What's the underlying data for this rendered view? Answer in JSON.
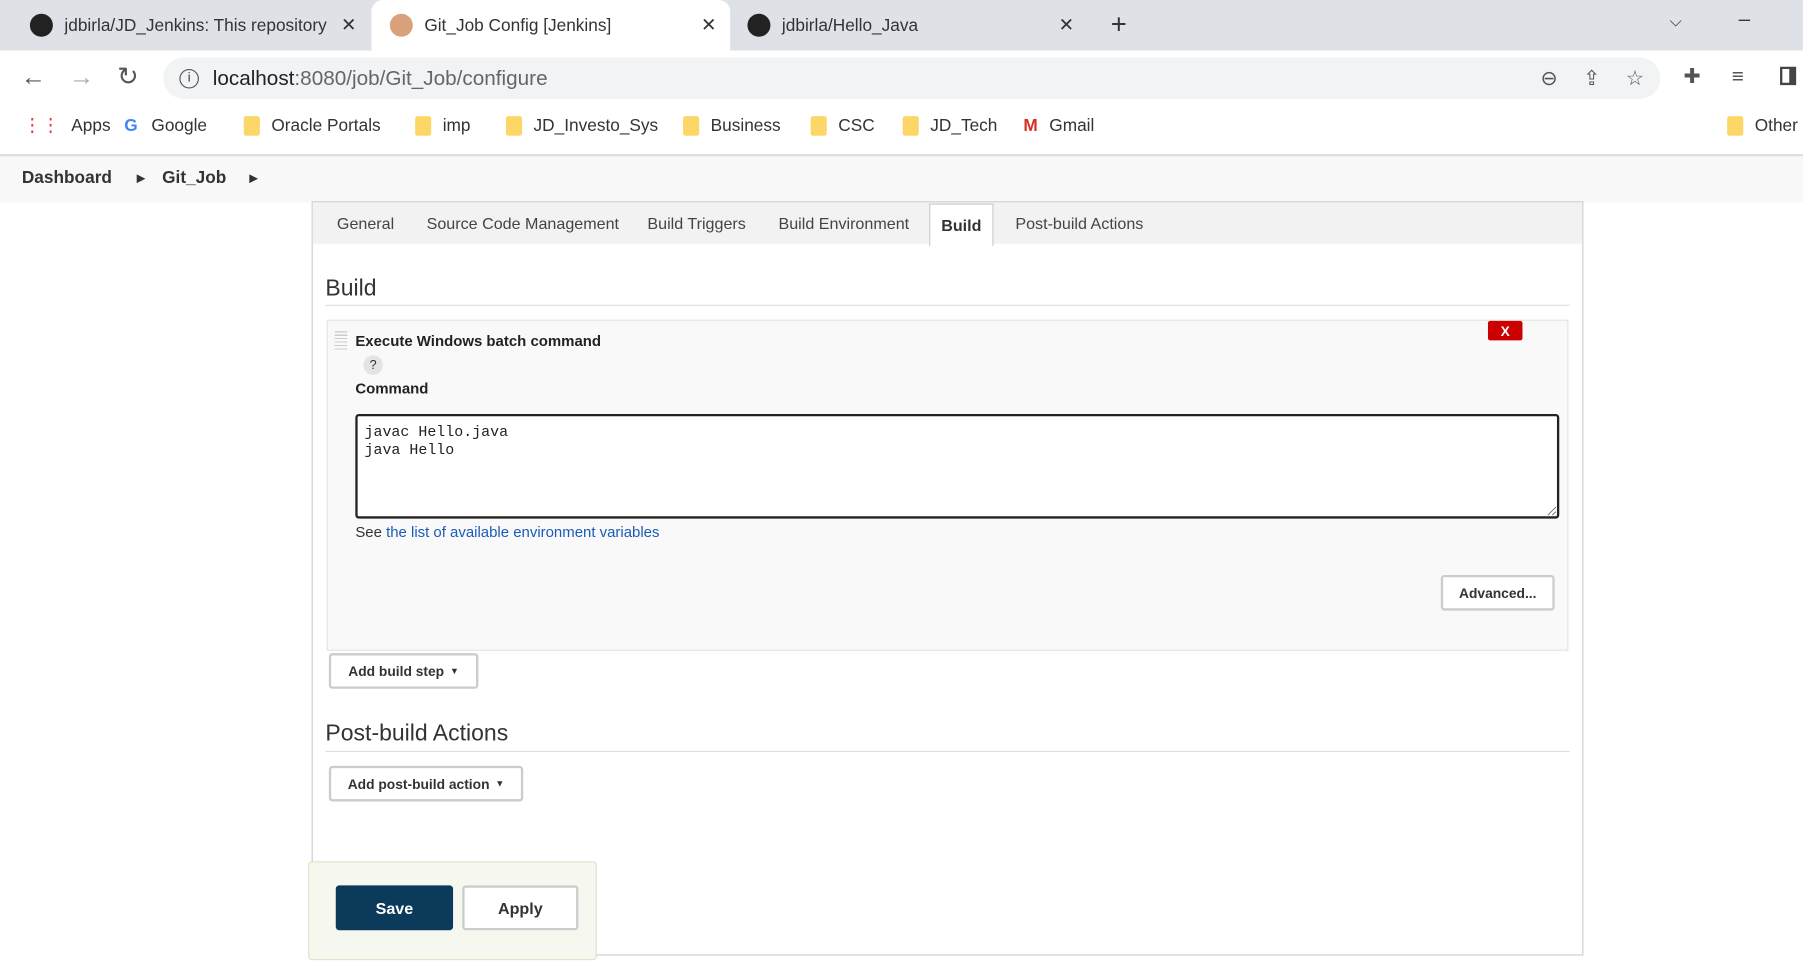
{
  "browser": {
    "tabs": [
      {
        "title": "jdbirla/JD_Jenkins: This repository",
        "icon": "github-icon"
      },
      {
        "title": "Git_Job Config [Jenkins]",
        "icon": "jenkins-icon"
      },
      {
        "title": "jdbirla/Hello_Java",
        "icon": "github-icon"
      }
    ],
    "url_host": "localhost",
    "url_path": ":8080/job/Git_Job/configure",
    "bookmarks": [
      "Apps",
      "Google",
      "Oracle Portals",
      "imp",
      "JD_Investo_Sys",
      "Business",
      "CSC",
      "JD_Tech",
      "Gmail"
    ],
    "other_bookmarks": "Other"
  },
  "breadcrumb": [
    "Dashboard",
    "Git_Job"
  ],
  "config_tabs": [
    "General",
    "Source Code Management",
    "Build Triggers",
    "Build Environment",
    "Build",
    "Post-build Actions"
  ],
  "active_tab": "Build",
  "build": {
    "heading": "Build",
    "step_title": "Execute Windows batch command",
    "help": "?",
    "delete": "X",
    "command_label": "Command",
    "command_value": "javac Hello.java\njava Hello",
    "see_prefix": "See ",
    "env_link": "the list of available environment variables",
    "advanced": "Advanced...",
    "add_step": "Add build step"
  },
  "post_build": {
    "heading": "Post-build Actions",
    "add_action": "Add post-build action"
  },
  "actions": {
    "save": "Save",
    "apply": "Apply"
  },
  "colors": {
    "save_bg": "#0b3a5b",
    "delete_bg": "#cc0000",
    "link": "#1a5bb8"
  }
}
